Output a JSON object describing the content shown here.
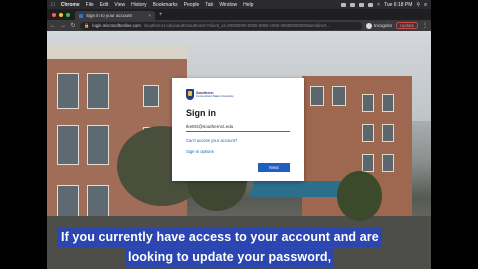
{
  "menubar": {
    "app": "Chrome",
    "items": [
      "File",
      "Edit",
      "View",
      "History",
      "Bookmarks",
      "People",
      "Tab",
      "Window",
      "Help"
    ],
    "clock": "Tue 6:18 PM"
  },
  "tab": {
    "title": "Sign in to your account",
    "close": "×",
    "new": "+"
  },
  "toolbar": {
    "url_host": "login.microsoftonline.com",
    "url_path": "/southernct.edu/oauth2/authorize?client_id=00000000-0000-0000-c000-000000000000&redirect...",
    "profile": "Incognito",
    "update": "Update"
  },
  "dialog": {
    "logo_line1": "Southern",
    "logo_line2": "Connecticut State University",
    "heading": "Sign in",
    "email": "IkettO@southernct.edu",
    "cant_access": "Can't access your account?",
    "sign_in_options": "Sign-in options",
    "next": "Next"
  },
  "caption": {
    "line1": "If you currently have access to your account and are",
    "line2": "looking to update your password,"
  }
}
